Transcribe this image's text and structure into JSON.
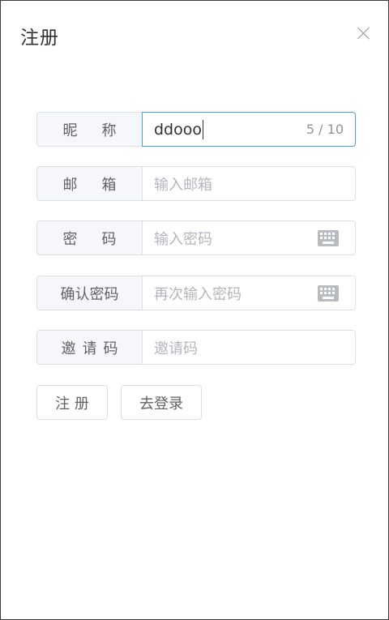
{
  "dialog": {
    "title": "注册"
  },
  "form": {
    "nickname": {
      "label": "昵称",
      "value": "ddooo",
      "counter": "5 / 10"
    },
    "email": {
      "label": "邮箱",
      "placeholder": "输入邮箱"
    },
    "password": {
      "label": "密码",
      "placeholder": "输入密码",
      "icon": "keyboard-icon"
    },
    "confirm_password": {
      "label": "确认密码",
      "placeholder": "再次输入密码",
      "icon": "keyboard-icon"
    },
    "invite_code": {
      "label": "邀请码",
      "placeholder": "邀请码"
    }
  },
  "buttons": {
    "register": "注 册",
    "go_login": "去登录"
  },
  "colors": {
    "focus_border": "#409eff",
    "label_bg": "#f5f7fa",
    "border": "#dcdfe6"
  }
}
